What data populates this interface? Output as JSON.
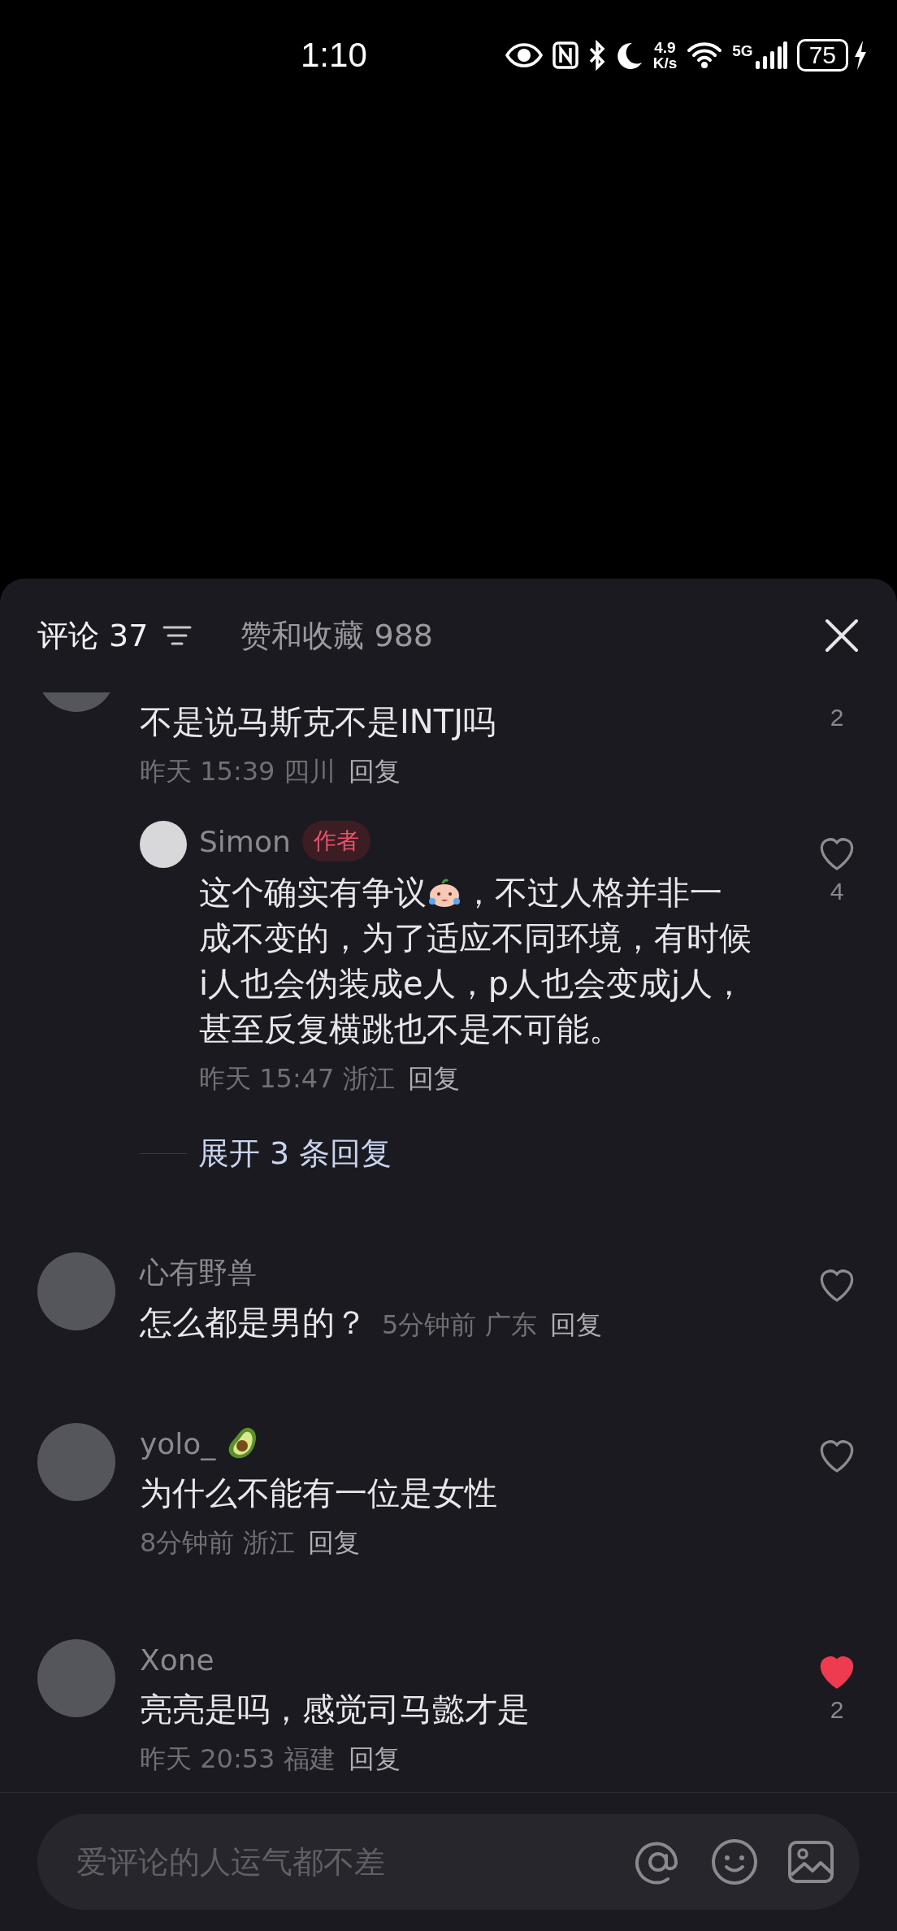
{
  "status_bar": {
    "time": "1:10",
    "net_speed": "4.9",
    "net_unit": "K/s",
    "network_type": "5G",
    "battery": "75",
    "charging": true
  },
  "comments_panel": {
    "tabs": [
      {
        "label": "评论 37",
        "selected": true
      },
      {
        "label": "赞和收藏 988",
        "selected": false
      }
    ],
    "comments": [
      {
        "cut": true,
        "text": "不是说马斯克不是INTJ吗",
        "time": "昨天 15:39 四川",
        "reply_label": "回复",
        "likes": "2",
        "replies": [
          {
            "name": "Simon",
            "author_badge": "作者",
            "segments": [
              {
                "kind": "text",
                "text": "这个确实有争议"
              },
              {
                "kind": "sticker"
              },
              {
                "kind": "text",
                "text": "，不过人格并非一成不变的，为了适应不同环境，有时候i人也会伪装成e人，p人也会变成j人，甚至反复横跳也不是不可能。"
              }
            ],
            "time": "昨天 15:47 浙江",
            "reply_label": "回复",
            "liked": false,
            "likes": "4"
          }
        ],
        "expand_label": "展开 3 条回复"
      },
      {
        "name": "心有野兽",
        "text": "怎么都是男的？",
        "meta_inline": true,
        "time": "5分钟前 广东",
        "reply_label": "回复",
        "liked": false
      },
      {
        "name": "yolo_",
        "name_avocado": true,
        "text": "为什么不能有一位是女性",
        "time": "8分钟前 浙江",
        "reply_label": "回复",
        "liked": false
      },
      {
        "name": "Xone",
        "text": "亮亮是吗，感觉司马懿才是",
        "time": "昨天 20:53 福建",
        "reply_label": "回复",
        "liked": true,
        "likes": "2"
      }
    ],
    "input": {
      "placeholder": "爱评论的人运气都不差"
    }
  }
}
